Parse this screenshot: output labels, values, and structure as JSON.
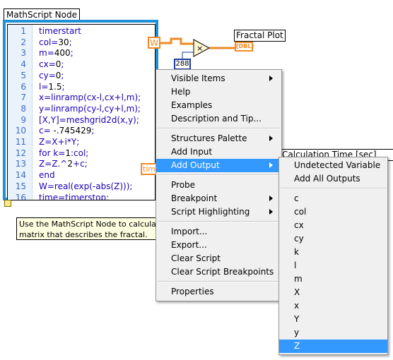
{
  "node": {
    "title": "MathScript Node",
    "lines": [
      {
        "n": "1",
        "parts": [
          {
            "t": "timerstart",
            "c": "kw"
          }
        ]
      },
      {
        "n": "2",
        "parts": [
          {
            "t": "col=",
            "c": "kw"
          },
          {
            "t": "30",
            "c": "num"
          },
          {
            "t": ";",
            "c": "kw"
          }
        ]
      },
      {
        "n": "3",
        "parts": [
          {
            "t": "m=",
            "c": "kw"
          },
          {
            "t": "400",
            "c": "num"
          },
          {
            "t": ";",
            "c": "kw"
          }
        ]
      },
      {
        "n": "4",
        "parts": [
          {
            "t": "cx=",
            "c": "kw"
          },
          {
            "t": "0",
            "c": "num"
          },
          {
            "t": ";",
            "c": "kw"
          }
        ]
      },
      {
        "n": "5",
        "parts": [
          {
            "t": "cy=",
            "c": "kw"
          },
          {
            "t": "0",
            "c": "num"
          },
          {
            "t": ";",
            "c": "kw"
          }
        ]
      },
      {
        "n": "6",
        "parts": [
          {
            "t": "l=",
            "c": "kw"
          },
          {
            "t": "1.5",
            "c": "num"
          },
          {
            "t": ";",
            "c": "kw"
          }
        ]
      },
      {
        "n": "7",
        "parts": [
          {
            "t": "x=linramp(cx-l,cx+l,m);",
            "c": "kw"
          }
        ]
      },
      {
        "n": "8",
        "parts": [
          {
            "t": "y=linramp(cy-l,cy+l,m);",
            "c": "kw"
          }
        ]
      },
      {
        "n": "9",
        "parts": [
          {
            "t": "[X,Y]=meshgrid2d(x,y);",
            "c": "kw"
          }
        ]
      },
      {
        "n": "10",
        "parts": [
          {
            "t": "c= ",
            "c": "kw"
          },
          {
            "t": "-.745429",
            "c": "num"
          },
          {
            "t": ";",
            "c": "kw"
          }
        ]
      },
      {
        "n": "11",
        "parts": [
          {
            "t": "Z=X+i*Y;",
            "c": "kw"
          }
        ]
      },
      {
        "n": "12",
        "parts": [
          {
            "t": "for k=",
            "c": "kw"
          },
          {
            "t": "1",
            "c": "num"
          },
          {
            "t": ":col;",
            "c": "kw"
          }
        ]
      },
      {
        "n": "13",
        "parts": [
          {
            "t": "Z=Z.^",
            "c": "kw"
          },
          {
            "t": "2",
            "c": "num"
          },
          {
            "t": "+c;",
            "c": "kw"
          }
        ]
      },
      {
        "n": "14",
        "parts": [
          {
            "t": "end",
            "c": "kw"
          }
        ]
      },
      {
        "n": "15",
        "parts": [
          {
            "t": "W=real(exp(-abs(Z)));",
            "c": "kw"
          }
        ]
      },
      {
        "n": "16",
        "parts": [
          {
            "t": "time=timerstop;",
            "c": "kw"
          }
        ]
      }
    ]
  },
  "tooltip": {
    "line1": "Use the MathScript Node to calculate",
    "line2": "matrix that describes the fractal."
  },
  "diagram": {
    "w_terminal": "W",
    "time_terminal": "time",
    "fractal_plot_label": "Fractal Plot",
    "dbl_label": "[DBL]",
    "constant_value": "288",
    "calc_time_label": "Calculation Time [sec]",
    "multiply_symbol": "×"
  },
  "context_menu": {
    "items": [
      {
        "label": "Visible Items",
        "submenu": true
      },
      {
        "label": "Help"
      },
      {
        "label": "Examples"
      },
      {
        "label": "Description and Tip..."
      },
      {
        "label": "Structures Palette",
        "submenu": true
      },
      {
        "label": "Add Input"
      },
      {
        "label": "Add Output",
        "submenu": true,
        "highlighted": true
      },
      {
        "label": "Probe"
      },
      {
        "label": "Breakpoint",
        "submenu": true
      },
      {
        "label": "Script Highlighting",
        "submenu": true
      },
      {
        "label": "Import..."
      },
      {
        "label": "Export..."
      },
      {
        "label": "Clear Script"
      },
      {
        "label": "Clear Script Breakpoints"
      },
      {
        "label": "Properties"
      }
    ]
  },
  "add_output_submenu": {
    "items": [
      {
        "label": "Undetected Variable"
      },
      {
        "label": "Add All Outputs"
      },
      {
        "label": "c"
      },
      {
        "label": "col"
      },
      {
        "label": "cx"
      },
      {
        "label": "cy"
      },
      {
        "label": "k"
      },
      {
        "label": "l"
      },
      {
        "label": "m"
      },
      {
        "label": "X"
      },
      {
        "label": "x"
      },
      {
        "label": "Y"
      },
      {
        "label": "y"
      },
      {
        "label": "Z",
        "highlighted": true
      }
    ]
  },
  "colors": {
    "node_border": "#1f8fd8",
    "wire_orange": "#f08a24",
    "menu_highlight": "#3399ff",
    "code_blue": "#1a00b5"
  }
}
